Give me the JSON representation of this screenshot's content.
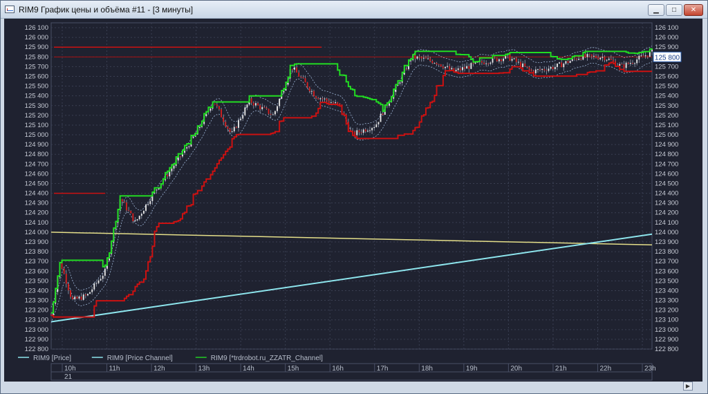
{
  "window": {
    "title": "RIM9 График цены и объёма #11 - [3 минуты]",
    "minimize_icon": "minimize-icon",
    "maximize_icon": "maximize-icon",
    "close_icon": "close-icon"
  },
  "chart_data": {
    "type": "candlestick",
    "y_ticks": [
      "126 100",
      "126 000",
      "125 900",
      "125 800",
      "125 700",
      "125 600",
      "125 500",
      "125 400",
      "125 300",
      "125 200",
      "125 100",
      "125 000",
      "124 900",
      "124 800",
      "124 700",
      "124 600",
      "124 500",
      "124 400",
      "124 300",
      "124 200",
      "124 100",
      "124 000",
      "123 900",
      "123 800",
      "123 700",
      "123 600",
      "123 500",
      "123 400",
      "123 300",
      "123 200",
      "123 100",
      "123 000",
      "122 900",
      "122 800"
    ],
    "ylim": [
      122800,
      126150
    ],
    "current_price_label": "125 800",
    "x_ticks": [
      "10h",
      "11h",
      "12h",
      "13h",
      "14h",
      "15h",
      "16h",
      "17h",
      "18h",
      "19h",
      "20h",
      "21h",
      "22h",
      "23h"
    ],
    "date_label": "21",
    "legend": [
      {
        "label": "RIM9 [Price]",
        "color": "#8ee6ee"
      },
      {
        "label": "RIM9 [Price Channel]",
        "color": "#8ee6ee"
      },
      {
        "label": "RIM9 [*trdrobot.ru_ZZATR_Channel]",
        "color": "#22cc22"
      }
    ],
    "colors": {
      "upper_channel": "#22dd22",
      "lower_channel": "#cc1111",
      "trend_line": "#8ee6ee",
      "level_line": "#e6e08a",
      "grid": "#3a3f52"
    }
  }
}
